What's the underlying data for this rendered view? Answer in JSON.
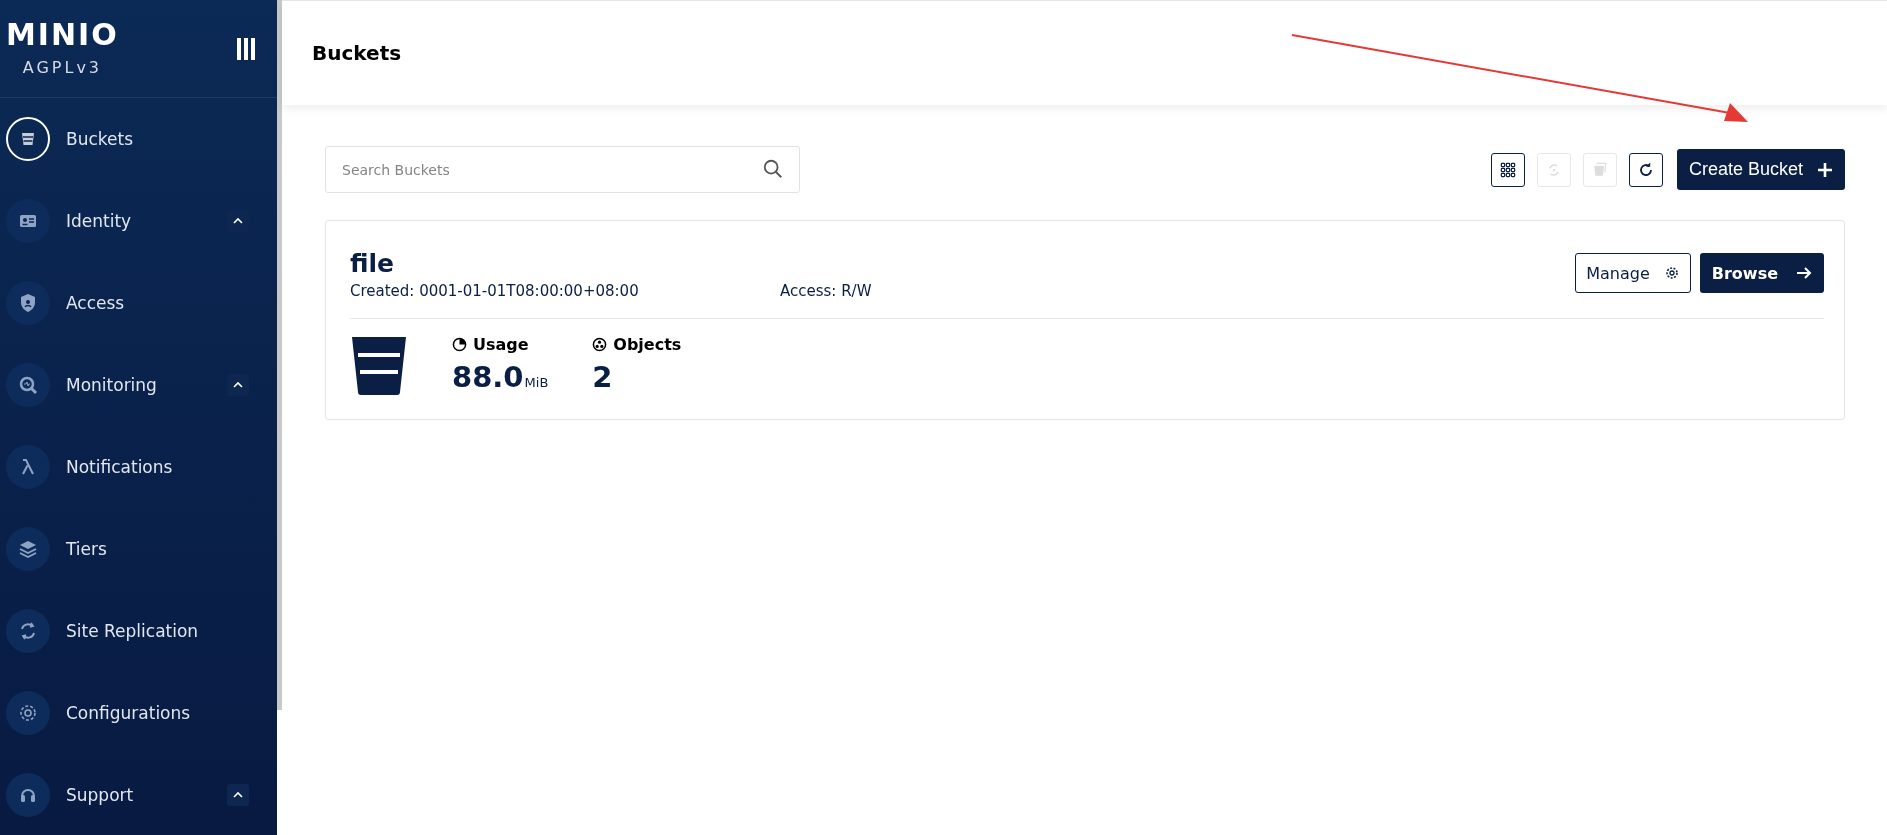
{
  "sidebar": {
    "logo": "MINIO",
    "edition": "AGPLv3",
    "items": [
      {
        "label": "Buckets",
        "kind": "link",
        "selected": true
      },
      {
        "label": "Identity",
        "kind": "group",
        "selected": false,
        "expanded": true
      },
      {
        "label": "Access",
        "kind": "link",
        "selected": false
      },
      {
        "label": "Monitoring",
        "kind": "group",
        "selected": false,
        "expanded": true
      },
      {
        "label": "Notifications",
        "kind": "link",
        "selected": false
      },
      {
        "label": "Tiers",
        "kind": "link",
        "selected": false
      },
      {
        "label": "Site Replication",
        "kind": "link",
        "selected": false
      },
      {
        "label": "Configurations",
        "kind": "link",
        "selected": false
      },
      {
        "label": "Support",
        "kind": "group",
        "selected": false,
        "expanded": true
      }
    ]
  },
  "header": {
    "title": "Buckets"
  },
  "toolbar": {
    "search": {
      "placeholder": "Search Buckets"
    },
    "tools": [
      {
        "kind": "grid",
        "disabled": false
      },
      {
        "kind": "sync",
        "disabled": true
      },
      {
        "kind": "delete",
        "disabled": true
      },
      {
        "kind": "refresh",
        "disabled": false
      }
    ],
    "create_button": "Create Bucket"
  },
  "buckets": [
    {
      "name": "file",
      "created": "Created: 0001-01-01T08:00:00+08:00",
      "access": "Access: R/W",
      "manage": "Manage",
      "browse": "Browse",
      "usage_label": "Usage",
      "usage_value": "88.0",
      "usage_unit": "MiB",
      "objects_label": "Objects",
      "objects_value": "2"
    }
  ]
}
